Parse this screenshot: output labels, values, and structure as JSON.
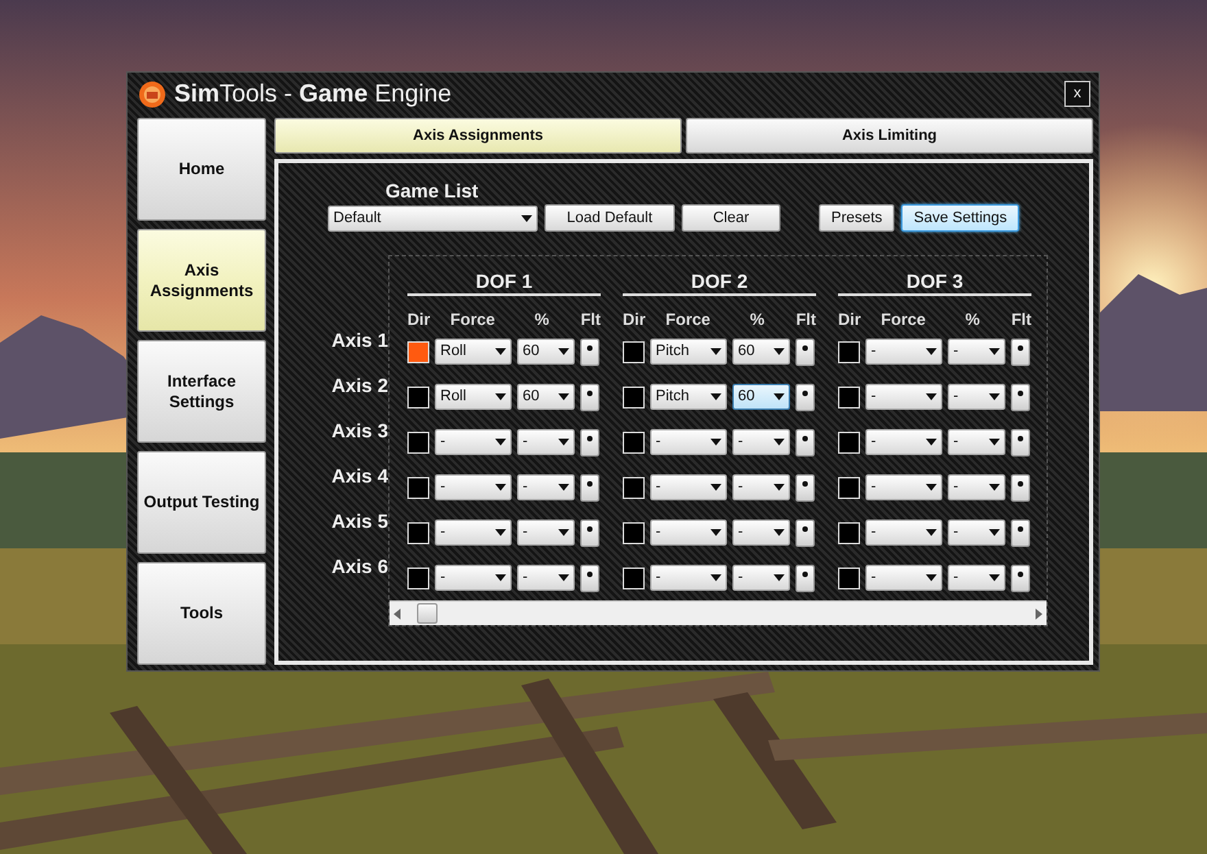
{
  "window": {
    "title": "**Sim**Tools - **Game** Engine",
    "close": "x"
  },
  "sidebar": {
    "items": [
      {
        "label": "Home",
        "selected": false
      },
      {
        "label": "Axis Assignments",
        "selected": true
      },
      {
        "label": "Interface Settings",
        "selected": false
      },
      {
        "label": "Output Testing",
        "selected": false
      },
      {
        "label": "Tools",
        "selected": false
      }
    ]
  },
  "tabs": [
    {
      "label": "Axis Assignments",
      "selected": true
    },
    {
      "label": "Axis Limiting",
      "selected": false
    }
  ],
  "game_list": {
    "label": "Game List",
    "value": "Default"
  },
  "buttons": [
    {
      "label": "Load Default",
      "focused": false,
      "gap_before": false
    },
    {
      "label": "Clear",
      "focused": false,
      "gap_before": false
    },
    {
      "label": "Presets",
      "focused": false,
      "gap_before": true
    },
    {
      "label": "Save Settings",
      "focused": true,
      "gap_before": false
    }
  ],
  "dofs": [
    {
      "title": "DOF 1",
      "headers": [
        "Dir",
        "Force",
        "%",
        "Flt"
      ]
    },
    {
      "title": "DOF 2",
      "headers": [
        "Dir",
        "Force",
        "%",
        "Flt"
      ]
    },
    {
      "title": "DOF 3",
      "headers": [
        "Dir",
        "Force",
        "%",
        "Flt"
      ]
    }
  ],
  "axes": [
    {
      "label": "Axis 1",
      "cells": [
        {
          "dir_checked": true,
          "force": "Roll",
          "percent": "60",
          "focused": false
        },
        {
          "dir_checked": false,
          "force": "Pitch",
          "percent": "60",
          "focused": false
        },
        {
          "dir_checked": false,
          "force": "-",
          "percent": "-",
          "focused": false
        }
      ]
    },
    {
      "label": "Axis 2",
      "cells": [
        {
          "dir_checked": false,
          "force": "Roll",
          "percent": "60",
          "focused": false
        },
        {
          "dir_checked": false,
          "force": "Pitch",
          "percent": "60",
          "focused": true
        },
        {
          "dir_checked": false,
          "force": "-",
          "percent": "-",
          "focused": false
        }
      ]
    },
    {
      "label": "Axis 3",
      "cells": [
        {
          "dir_checked": false,
          "force": "-",
          "percent": "-",
          "focused": false
        },
        {
          "dir_checked": false,
          "force": "-",
          "percent": "-",
          "focused": false
        },
        {
          "dir_checked": false,
          "force": "-",
          "percent": "-",
          "focused": false
        }
      ]
    },
    {
      "label": "Axis 4",
      "cells": [
        {
          "dir_checked": false,
          "force": "-",
          "percent": "-",
          "focused": false
        },
        {
          "dir_checked": false,
          "force": "-",
          "percent": "-",
          "focused": false
        },
        {
          "dir_checked": false,
          "force": "-",
          "percent": "-",
          "focused": false
        }
      ]
    },
    {
      "label": "Axis 5",
      "cells": [
        {
          "dir_checked": false,
          "force": "-",
          "percent": "-",
          "focused": false
        },
        {
          "dir_checked": false,
          "force": "-",
          "percent": "-",
          "focused": false
        },
        {
          "dir_checked": false,
          "force": "-",
          "percent": "-",
          "focused": false
        }
      ]
    },
    {
      "label": "Axis 6",
      "cells": [
        {
          "dir_checked": false,
          "force": "-",
          "percent": "-",
          "focused": false
        },
        {
          "dir_checked": false,
          "force": "-",
          "percent": "-",
          "focused": false
        },
        {
          "dir_checked": false,
          "force": "-",
          "percent": "-",
          "focused": false
        }
      ]
    }
  ]
}
